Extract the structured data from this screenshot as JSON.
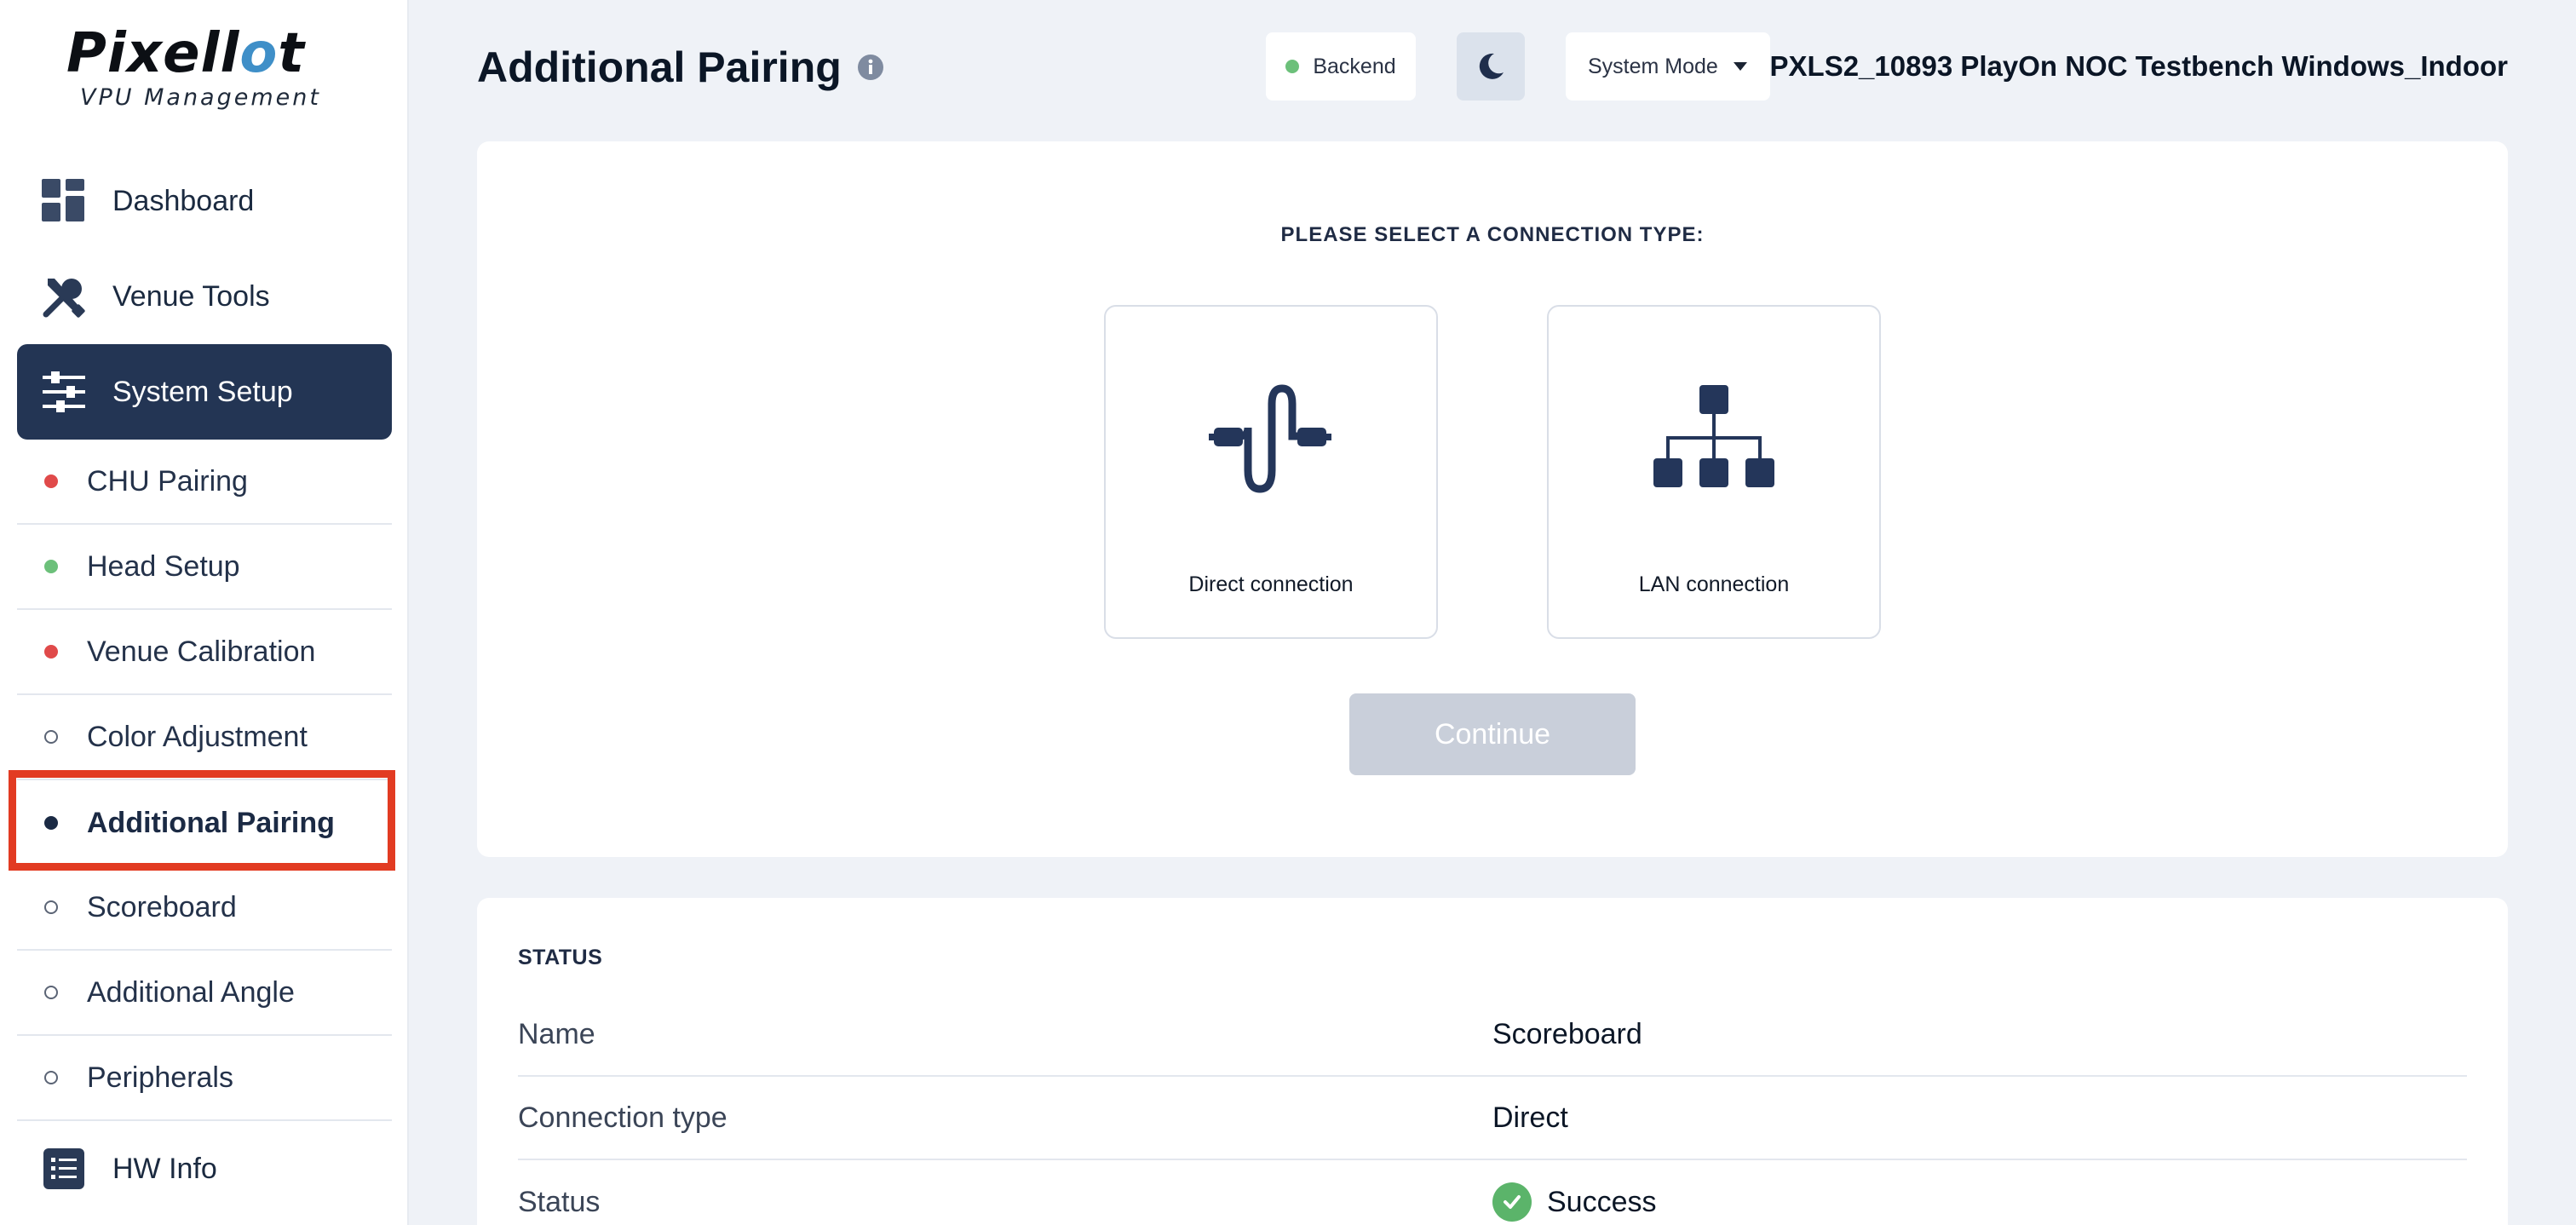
{
  "brand": {
    "logo_main": "Pixell",
    "logo_accent": "o",
    "logo_tail": "t",
    "logo_sub": "VPU Management",
    "accent_color": "#3f8fc8"
  },
  "sidebar": {
    "main_items": [
      {
        "label": "Dashboard",
        "icon": "grid-icon"
      },
      {
        "label": "Venue Tools",
        "icon": "tools-icon"
      },
      {
        "label": "System Setup",
        "icon": "sliders-icon",
        "active": true
      }
    ],
    "sub_items": [
      {
        "label": "CHU Pairing",
        "status": "error"
      },
      {
        "label": "Head Setup",
        "status": "ok"
      },
      {
        "label": "Venue Calibration",
        "status": "error"
      },
      {
        "label": "Color Adjustment",
        "status": "none"
      },
      {
        "label": "Additional Pairing",
        "status": "current"
      },
      {
        "label": "Scoreboard",
        "status": "none"
      },
      {
        "label": "Additional Angle",
        "status": "none"
      },
      {
        "label": "Peripherals",
        "status": "none"
      }
    ],
    "bottom_item": {
      "label": "HW Info",
      "icon": "list-icon"
    },
    "status_colors": {
      "error": "#e04a4a",
      "ok": "#6cc07a",
      "current": "#1b2a44"
    }
  },
  "header": {
    "title": "Additional Pairing",
    "backend_label": "Backend",
    "backend_status_color": "#6cc07a",
    "mode_label": "System Mode",
    "device_name": "PXLS2_10893 PlayOn NOC Testbench Windows_Indoor"
  },
  "connection": {
    "heading": "PLEASE SELECT A CONNECTION TYPE:",
    "options": [
      {
        "label": "Direct connection",
        "icon": "cable-icon"
      },
      {
        "label": "LAN connection",
        "icon": "network-icon"
      }
    ],
    "continue_label": "Continue"
  },
  "status": {
    "heading": "STATUS",
    "rows": [
      {
        "key": "Name",
        "value": "Scoreboard"
      },
      {
        "key": "Connection type",
        "value": "Direct"
      },
      {
        "key": "Status",
        "value": "Success",
        "icon": "check-icon"
      }
    ]
  }
}
